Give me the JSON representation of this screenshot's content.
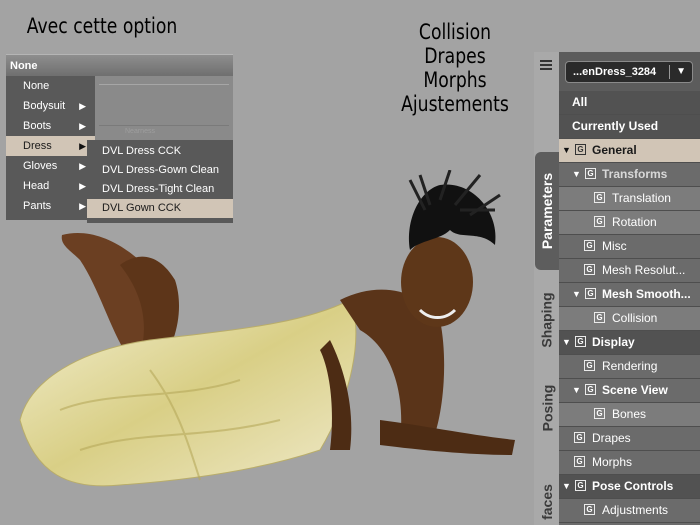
{
  "captions": {
    "left": "Avec cette option",
    "right": [
      "Collision",
      "Drapes",
      "Morphs",
      "Ajustements"
    ]
  },
  "menu": {
    "header": "None",
    "items": [
      {
        "label": "None",
        "has_submenu": false
      },
      {
        "label": "Bodysuit",
        "has_submenu": true
      },
      {
        "label": "Boots",
        "has_submenu": true
      },
      {
        "label": "Dress",
        "has_submenu": true,
        "active": true
      },
      {
        "label": "Gloves",
        "has_submenu": true
      },
      {
        "label": "Head",
        "has_submenu": true
      },
      {
        "label": "Pants",
        "has_submenu": true
      }
    ],
    "submenu": [
      {
        "label": "DVL Dress CCK"
      },
      {
        "label": "DVL Dress-Gown Clean"
      },
      {
        "label": "DVL Dress-Tight Clean"
      },
      {
        "label": "DVL Gown CCK",
        "active": true
      }
    ],
    "background_watermark": "Nearness"
  },
  "tabs": [
    {
      "label": "Parameters",
      "active": true
    },
    {
      "label": "Shaping",
      "active": false
    },
    {
      "label": "Posing",
      "active": false
    },
    {
      "label": "faces",
      "active": false
    }
  ],
  "panel": {
    "node_selector": "...enDress_3284",
    "rows": [
      {
        "label": "All",
        "style": "dark",
        "bold": true
      },
      {
        "label": "Currently Used",
        "style": "dark",
        "bold": true
      },
      {
        "label": "General",
        "style": "sel",
        "bold": true,
        "tri": true,
        "g": true
      },
      {
        "label": "Transforms",
        "style": "mid",
        "bold": true,
        "tri": true,
        "g": true,
        "muted": true
      },
      {
        "label": "Translation",
        "style": "light",
        "g": true
      },
      {
        "label": "Rotation",
        "style": "light",
        "g": true
      },
      {
        "label": "Misc",
        "style": "mid",
        "g": true
      },
      {
        "label": "Mesh Resolut...",
        "style": "mid",
        "g": true
      },
      {
        "label": "Mesh Smooth...",
        "style": "mid",
        "bold": true,
        "tri": true,
        "g": true
      },
      {
        "label": "Collision",
        "style": "light",
        "g": true
      },
      {
        "label": "Display",
        "style": "dark",
        "bold": true,
        "tri": true,
        "g": true
      },
      {
        "label": "Rendering",
        "style": "mid",
        "g": true
      },
      {
        "label": "Scene View",
        "style": "mid",
        "bold": true,
        "tri": true,
        "g": true
      },
      {
        "label": "Bones",
        "style": "light",
        "g": true
      },
      {
        "label": "Drapes",
        "style": "mid",
        "g": true
      },
      {
        "label": "Morphs",
        "style": "mid",
        "g": true
      },
      {
        "label": "Pose Controls",
        "style": "dark",
        "bold": true,
        "tri": true,
        "g": true
      },
      {
        "label": "Adjustments",
        "style": "mid",
        "g": true
      }
    ]
  },
  "colors": {
    "viewport_bg": "#a3a3a3",
    "panel_bg": "#6c6c6c",
    "selection": "#d1c5b6",
    "menu_bg": "#595959"
  },
  "icons": {
    "group": "G",
    "expanded": "▼",
    "submenu": "▶",
    "dropdown": "▼"
  }
}
